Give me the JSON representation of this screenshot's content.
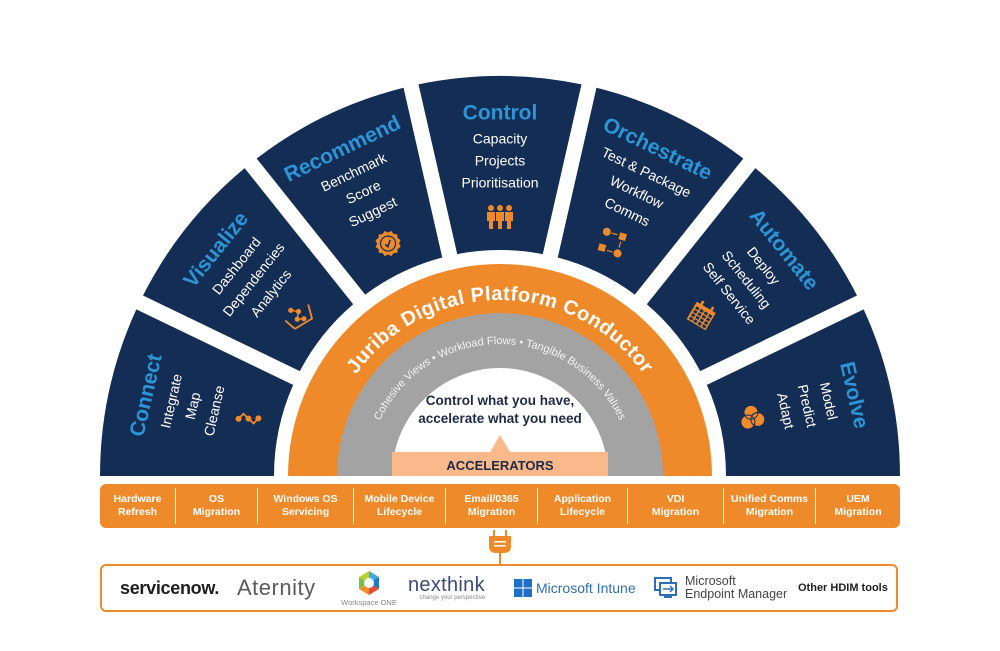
{
  "colors": {
    "navy": "#142d54",
    "blue_title": "#2b95d6",
    "orange": "#ef8a2a",
    "grey": "#a3a3a3",
    "peach": "#f9b98a",
    "white": "#ffffff",
    "dark_text": "#1e2a44"
  },
  "segments": [
    {
      "title": "Connect",
      "items": [
        "Integrate",
        "Map",
        "Cleanse"
      ],
      "icon": "process-path-icon"
    },
    {
      "title": "Visualize",
      "items": [
        "Dashboard",
        "Dependencies",
        "Analytics"
      ],
      "icon": "graph-chart-icon"
    },
    {
      "title": "Recommend",
      "items": [
        "Benchmark",
        "Score",
        "Suggest"
      ],
      "icon": "badge-check-icon"
    },
    {
      "title": "Control",
      "items": [
        "Capacity",
        "Projects",
        "Prioritisation"
      ],
      "icon": "team-people-icon"
    },
    {
      "title": "Orchestrate",
      "items": [
        "Test & Package",
        "Workflow",
        "Comms"
      ],
      "icon": "workflow-icon"
    },
    {
      "title": "Automate",
      "items": [
        "Deploy",
        "Scheduling",
        "Self Service"
      ],
      "icon": "calendar-icon"
    },
    {
      "title": "Evolve",
      "items": [
        "Model",
        "Predict",
        "Adapt"
      ],
      "icon": "venn-circles-icon"
    }
  ],
  "platform": {
    "title": "Juriba Digital Platform Conductor",
    "values": "Cohesive Views  •  Workload Flows  •  Tangible Business Values",
    "tagline_line1": "Control what you have,",
    "tagline_line2": "accelerate what you need",
    "accelerators_label": "ACCELERATORS"
  },
  "accelerators": [
    {
      "line1": "Hardware",
      "line2": "Refresh"
    },
    {
      "line1": "OS",
      "line2": "Migration"
    },
    {
      "line1": "Windows OS",
      "line2": "Servicing"
    },
    {
      "line1": "Mobile Device",
      "line2": "Lifecycle"
    },
    {
      "line1": "Email/0365",
      "line2": "Migration"
    },
    {
      "line1": "Application",
      "line2": "Lifecycle"
    },
    {
      "line1": "VDI",
      "line2": "Migration"
    },
    {
      "line1": "Unified Comms",
      "line2": "Migration"
    },
    {
      "line1": "UEM",
      "line2": "Migration"
    }
  ],
  "tools": {
    "servicenow": "servicenow.",
    "aternity": "Aternity",
    "workspace_one": "Workspace ONE",
    "nexthink": "nexthink",
    "nexthink_tagline": "change your perspective",
    "intune": "Microsoft Intune",
    "mem_line1": "Microsoft",
    "mem_line2": "Endpoint Manager",
    "other": "Other HDIM tools"
  }
}
